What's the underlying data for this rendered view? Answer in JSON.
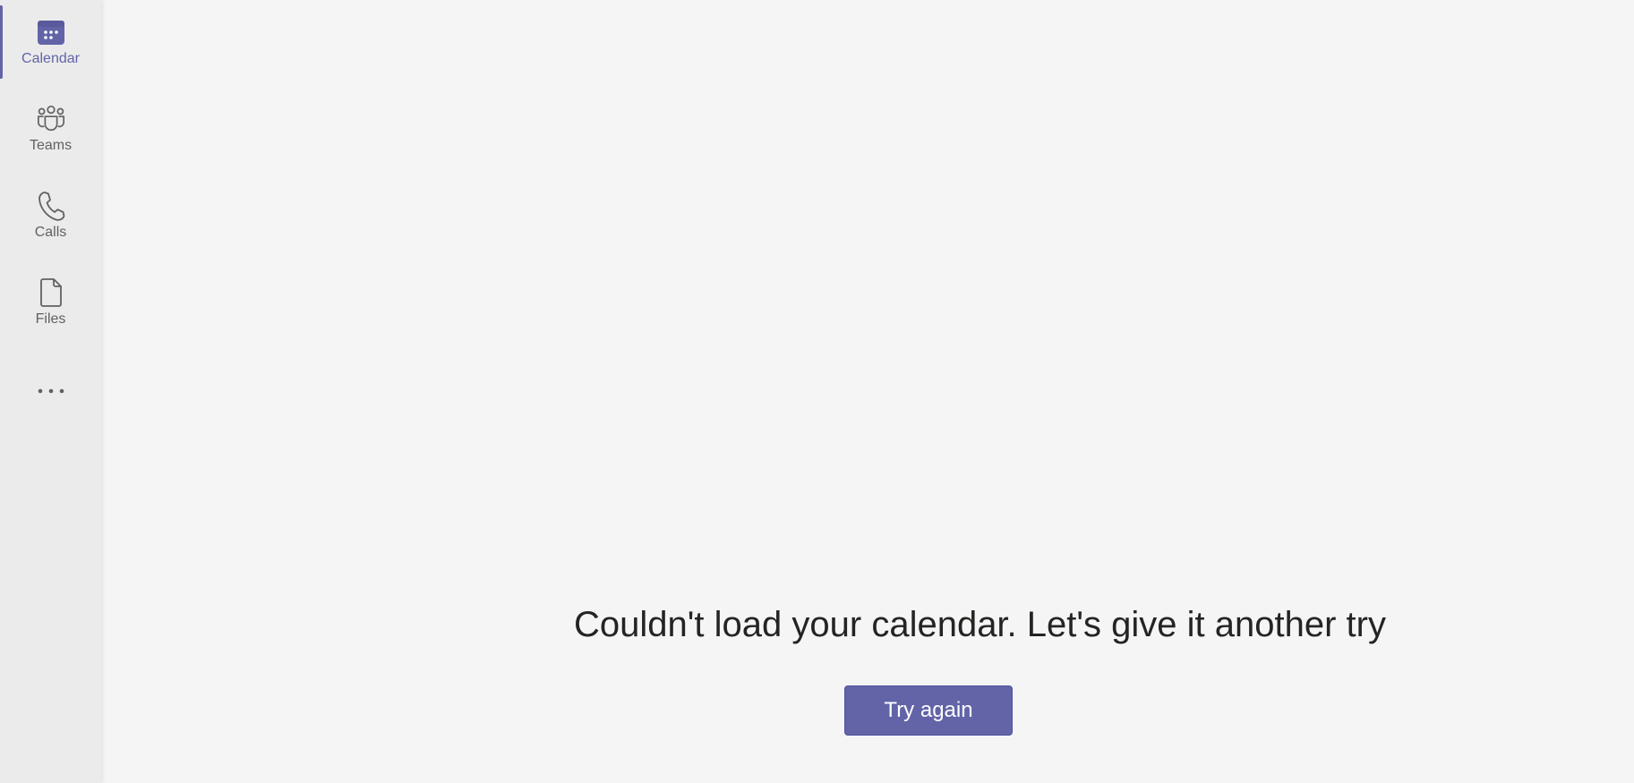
{
  "rail": {
    "items": [
      {
        "label": "Calendar",
        "icon": "calendar-icon",
        "active": true
      },
      {
        "label": "Teams",
        "icon": "teams-icon",
        "active": false
      },
      {
        "label": "Calls",
        "icon": "phone-icon",
        "active": false
      },
      {
        "label": "Files",
        "icon": "file-icon",
        "active": false
      }
    ],
    "more_icon": "more-horizontal-icon"
  },
  "main": {
    "error_message": "Couldn't load your calendar. Let's give it another try",
    "retry_label": "Try again"
  },
  "colors": {
    "accent": "#6264a7",
    "rail_bg": "#ebebeb",
    "main_bg": "#f5f5f5",
    "text_primary": "#252423",
    "text_secondary": "#616161"
  }
}
